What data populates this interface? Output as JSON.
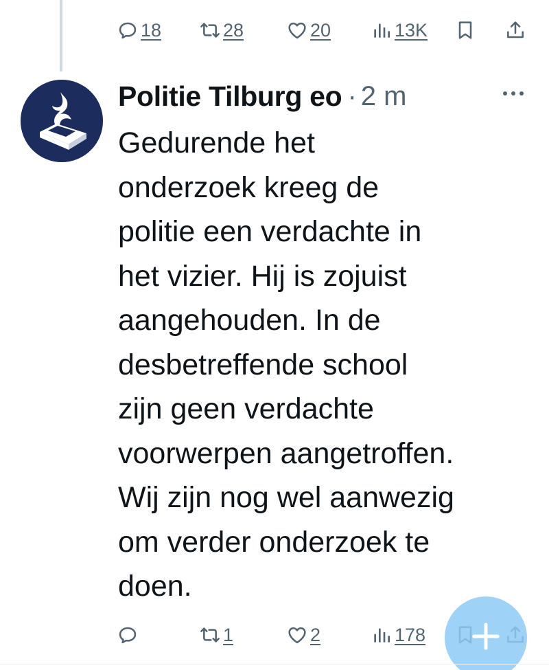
{
  "previous_tweet": {
    "replies": "18",
    "retweets": "28",
    "likes": "20",
    "views": "13K"
  },
  "tweet": {
    "author_name": "Politie Tilburg eo",
    "separator": "·",
    "time": "2 m",
    "text": "Gedurende het\nonderzoek kreeg de\npolitie een verdachte in\nhet vizier. Hij is zojuist\naangehouden. In de\ndesbetreffende school\nzijn geen verdachte\nvoorwerpen aangetroffen.\nWij zijn nog wel aanwezig\nom verder onderzoek te\ndoen.",
    "replies": "",
    "retweets": "1",
    "likes": "2",
    "views": "178"
  },
  "icons": {
    "reply": "reply-icon",
    "retweet": "retweet-icon",
    "like": "heart-icon",
    "views": "views-icon",
    "bookmark": "bookmark-icon",
    "share": "share-icon",
    "more": "more-icon",
    "compose": "plus-icon"
  },
  "colors": {
    "text": "#0f1419",
    "secondary": "#536471",
    "avatar_bg": "#1c2c5c",
    "fab": "#8ecbf5",
    "thread_line": "#cfd9de"
  }
}
